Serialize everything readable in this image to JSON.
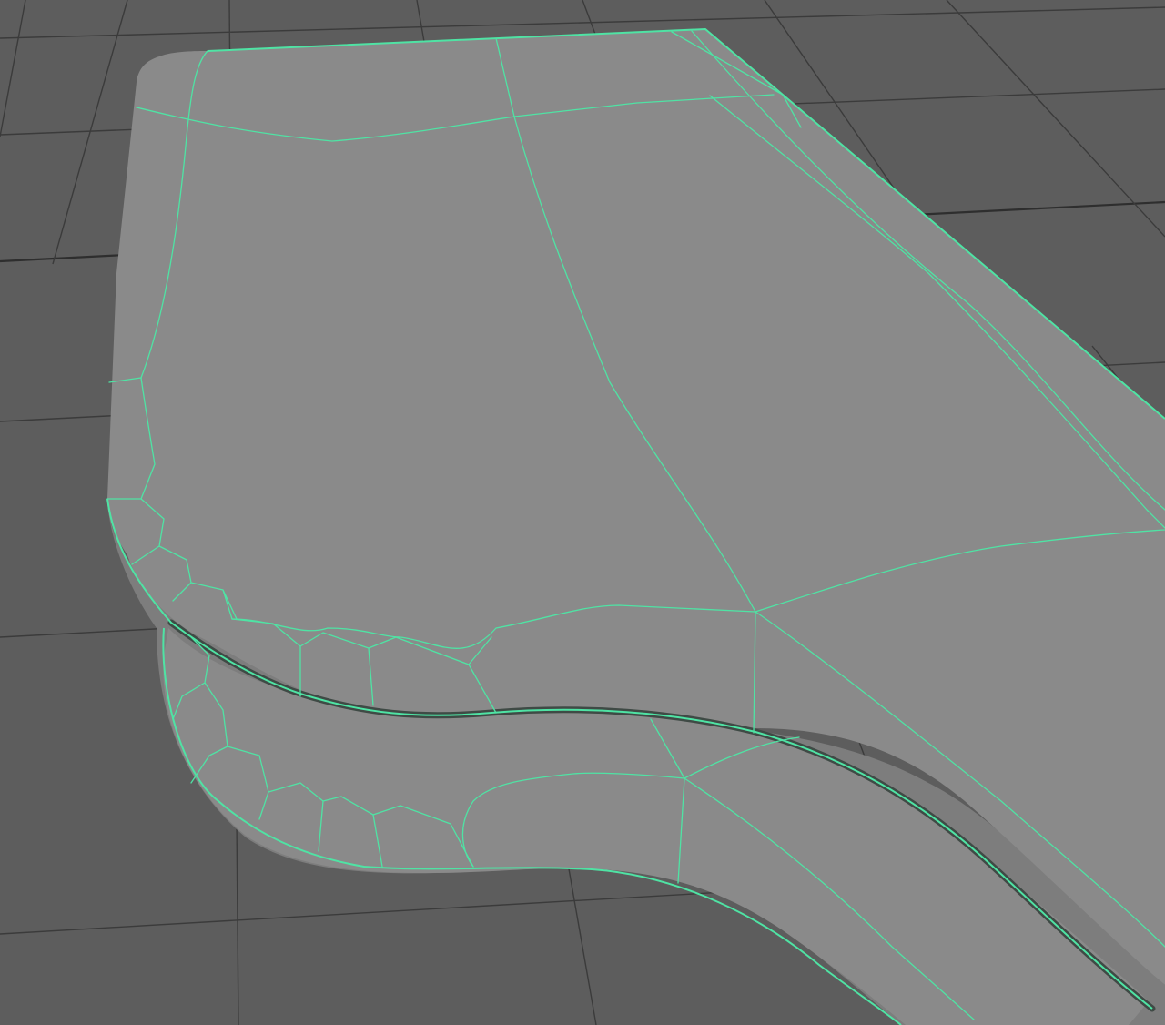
{
  "viewport": {
    "background_color": "#5d5d5d",
    "grid_color": "#3b3b3b",
    "grid_axis_color": "#2e2e2e"
  },
  "mesh": {
    "surface_color": "#8a8a8a",
    "side_color": "#7d7d7d",
    "groove_color": "#3f4a45",
    "wireframe_color": "#4fe3a4",
    "selected": true
  }
}
